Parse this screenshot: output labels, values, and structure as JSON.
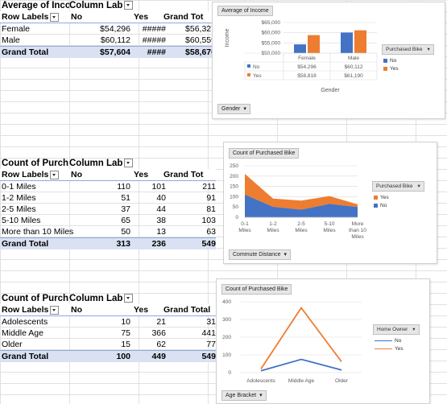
{
  "pivot1": {
    "title": "Average of Inco",
    "col_label": "Column Lab",
    "row_labels": "Row Labels",
    "h_no": "No",
    "h_yes": "Yes",
    "h_total": "Grand Tot",
    "rows": [
      {
        "label": "Female",
        "no": "$54,296",
        "yes": "#####",
        "total": "$56,327"
      },
      {
        "label": "Male",
        "no": "$60,112",
        "yes": "#####",
        "total": "$60,559"
      }
    ],
    "grand": {
      "label": "Grand Total",
      "no": "$57,604",
      "yes": "####",
      "total": "$58,670"
    }
  },
  "pivot2": {
    "title": "Count of Purch",
    "col_label": "Column Lab",
    "row_labels": "Row Labels",
    "h_no": "No",
    "h_yes": "Yes",
    "h_total": "Grand Tot",
    "rows": [
      {
        "label": "0-1 Miles",
        "no": "110",
        "yes": "101",
        "total": "211"
      },
      {
        "label": "1-2 Miles",
        "no": "51",
        "yes": "40",
        "total": "91"
      },
      {
        "label": "2-5 Miles",
        "no": "37",
        "yes": "44",
        "total": "81"
      },
      {
        "label": "5-10 Miles",
        "no": "65",
        "yes": "38",
        "total": "103"
      },
      {
        "label": "More than 10 Miles",
        "no": "50",
        "yes": "13",
        "total": "63"
      }
    ],
    "grand": {
      "label": "Grand Total",
      "no": "313",
      "yes": "236",
      "total": "549"
    }
  },
  "pivot3": {
    "title": "Count of Purch",
    "col_label": "Column Lab",
    "row_labels": "Row Labels",
    "h_no": "No",
    "h_yes": "Yes",
    "h_total": "Grand Total",
    "rows": [
      {
        "label": "Adolescents",
        "no": "10",
        "yes": "21",
        "total": "31"
      },
      {
        "label": "Middle Age",
        "no": "75",
        "yes": "366",
        "total": "441"
      },
      {
        "label": "Older",
        "no": "15",
        "yes": "62",
        "total": "77"
      }
    ],
    "grand": {
      "label": "Grand Total",
      "no": "100",
      "yes": "449",
      "total": "549"
    }
  },
  "colors": {
    "no": "#4472c4",
    "yes": "#ed7d31",
    "axis": "#d9d9d9",
    "text": "#595959"
  },
  "chart_data": [
    {
      "type": "bar",
      "title": "Average of Income",
      "categories": [
        "Female",
        "Male"
      ],
      "series": [
        {
          "name": "No",
          "values": [
            54296,
            60112
          ]
        },
        {
          "name": "Yes",
          "values": [
            58818,
            61190
          ]
        }
      ],
      "ylabel": "Income",
      "xlabel": "Gender",
      "yticks": [
        "$65,000",
        "$60,000",
        "$55,000",
        "$50,000"
      ],
      "ylim": [
        50000,
        65000
      ],
      "table_rows": [
        {
          "name": "No",
          "cells": [
            "$54,296",
            "$60,112"
          ]
        },
        {
          "name": "Yes",
          "cells": [
            "$58,818",
            "$61,190"
          ]
        }
      ],
      "legend_title": "Purchased Bike",
      "legend": [
        "No",
        "Yes"
      ],
      "filter_button": "Gender"
    },
    {
      "type": "area",
      "title": "Count of Purchased Bike",
      "categories": [
        "0-1 Miles",
        "1-2 Miles",
        "2-5 Miles",
        "5-10 Miles",
        "More than 10 Miles"
      ],
      "category_lines": [
        [
          "0-1",
          "Miles"
        ],
        [
          "1-2",
          "Miles"
        ],
        [
          "2-5",
          "Miles"
        ],
        [
          "5-10",
          "Miles"
        ],
        [
          "More",
          "than 10",
          "Miles"
        ]
      ],
      "series": [
        {
          "name": "No",
          "values": [
            110,
            51,
            37,
            65,
            50
          ]
        },
        {
          "name": "Yes",
          "values": [
            101,
            40,
            44,
            38,
            13
          ]
        }
      ],
      "stacked": true,
      "yticks": [
        "250",
        "200",
        "150",
        "100",
        "50",
        "0"
      ],
      "ylim": [
        0,
        250
      ],
      "legend_title": "Purchased Bike",
      "legend": [
        "Yes",
        "No"
      ],
      "filter_button": "Commute Distance"
    },
    {
      "type": "line",
      "title": "Count of Purchased Bike",
      "categories": [
        "Adolescents",
        "Middle Age",
        "Older"
      ],
      "series": [
        {
          "name": "No",
          "values": [
            10,
            75,
            15
          ]
        },
        {
          "name": "Yes",
          "values": [
            21,
            366,
            62
          ]
        }
      ],
      "yticks": [
        "400",
        "300",
        "200",
        "100",
        "0"
      ],
      "ylim": [
        0,
        400
      ],
      "legend_title": "Home Owner",
      "legend": [
        "No",
        "Yes"
      ],
      "filter_button": "Age Bracket"
    }
  ]
}
